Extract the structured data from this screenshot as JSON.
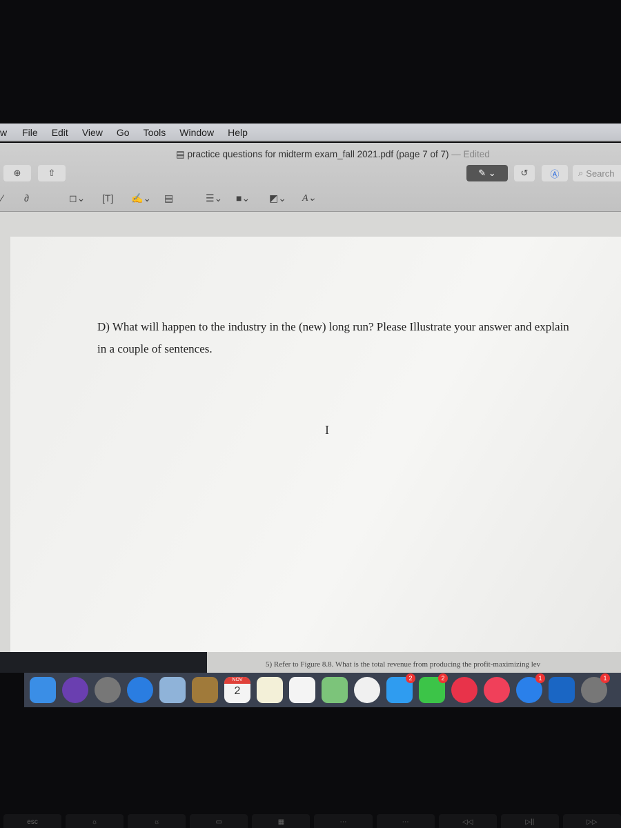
{
  "menubar": {
    "items": [
      "w",
      "File",
      "Edit",
      "View",
      "Go",
      "Tools",
      "Window",
      "Help"
    ]
  },
  "window": {
    "title": "practice questions for midterm exam_fall 2021.pdf (page 7 of 7)",
    "edited": "— Edited",
    "search_placeholder": "Search"
  },
  "document": {
    "question": "D) What will happen to the industry in the (new) long run? Please Illustrate your answer and explain in a couple of sentences.",
    "cursor": "I",
    "next_question": "5) Refer to Figure 8.8. What is the total revenue from producing the profit-maximizing lev"
  },
  "dock": {
    "apps": [
      {
        "name": "finder",
        "color": "#3a8ee6"
      },
      {
        "name": "siri",
        "color": "#6a3fb0"
      },
      {
        "name": "launchpad",
        "color": "#777"
      },
      {
        "name": "safari",
        "color": "#2a7de1"
      },
      {
        "name": "preview",
        "color": "#8fb3d9"
      },
      {
        "name": "notebook",
        "color": "#a07a3a"
      },
      {
        "name": "calendar",
        "color": "#f4f4f4",
        "label": "2",
        "month": "NOV"
      },
      {
        "name": "notes",
        "color": "#f3f0d8"
      },
      {
        "name": "reminders",
        "color": "#f4f4f4"
      },
      {
        "name": "maps",
        "color": "#7cc47a"
      },
      {
        "name": "photos",
        "color": "#f0f0f0"
      },
      {
        "name": "messages",
        "color": "#2f9cf0",
        "badge": "2"
      },
      {
        "name": "facetime",
        "color": "#3cc448",
        "badge": "2"
      },
      {
        "name": "news",
        "color": "#e8334a"
      },
      {
        "name": "music",
        "color": "#f0405a"
      },
      {
        "name": "app-store",
        "color": "#2a80ea",
        "badge": "1"
      },
      {
        "name": "outlook",
        "color": "#1a66c4"
      },
      {
        "name": "system-preferences",
        "color": "#777",
        "badge": "1"
      }
    ]
  },
  "keyboard": {
    "keys": [
      "esc",
      "☼",
      "☼",
      "▭",
      "▦",
      "⋯",
      "⋯",
      "◁◁",
      "▷||",
      "▷▷"
    ]
  }
}
